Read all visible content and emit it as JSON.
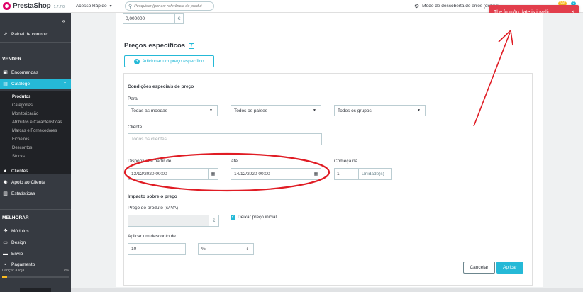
{
  "header": {
    "brand": "PrestaShop",
    "version": "1.7.7.0",
    "quick_access": "Acesso Rápido",
    "search_placeholder": "Pesquisar (por ex: referência do produt",
    "debug_mode": "Modo de descoberta de erros (debug)",
    "notification_badge": "666",
    "orders_badge": "2"
  },
  "toast": {
    "message": "The from/to date is invalid.",
    "close": "×"
  },
  "sidebar": {
    "collapse": "«",
    "dashboard": "Painel de controlo",
    "section_sell": "VENDER",
    "orders": "Encomendas",
    "catalog": "Catálogo",
    "catalog_sub": [
      "Produtos",
      "Categorias",
      "Monitorização",
      "Atributos e Características",
      "Marcas e Fornecedores",
      "Ficheiros",
      "Descontos",
      "Stocks"
    ],
    "customers": "Clientes",
    "support": "Apoio ao Cliente",
    "stats": "Estatísticas",
    "section_improve": "MELHORAR",
    "modules": "Módulos",
    "design": "Design",
    "shipping": "Envio",
    "payment": "Pagamento",
    "launch_label": "Lançar a loja",
    "launch_progress": "7%",
    "launch_progress_value": 0.07
  },
  "main": {
    "cost_value": "0,000000",
    "currency": "€",
    "section_title": "Preços específicos",
    "add_button": "Adicionar um preço específico",
    "conditions_title": "Condições especiais de preço",
    "for_label": "Para",
    "currency_select": "Todas as moedas",
    "country_select": "Todos os países",
    "group_select": "Todos os grupos",
    "customer_label": "Cliente",
    "customer_placeholder": "Todos os clientes",
    "from_label": "Disponível a partir de",
    "to_label": "até",
    "starting_label": "Começa na",
    "from_date": "13/12/2020 00:00",
    "to_date": "14/12/2020 00:00",
    "starting_value": "1",
    "unit_label": "Unidade(s)",
    "impact_title": "Impacto sobre o preço",
    "price_label": "Preço do produto (s/IVA)",
    "keep_price": "Deixar preço inicial",
    "discount_label": "Aplicar um desconto de",
    "discount_value": "10",
    "discount_type": "%",
    "cancel": "Cancelar",
    "apply": "Aplicar"
  },
  "colors": {
    "accent": "#25b9d7",
    "error": "#e23e4c",
    "annotation": "#e01c24",
    "sidebar": "#363a41"
  }
}
